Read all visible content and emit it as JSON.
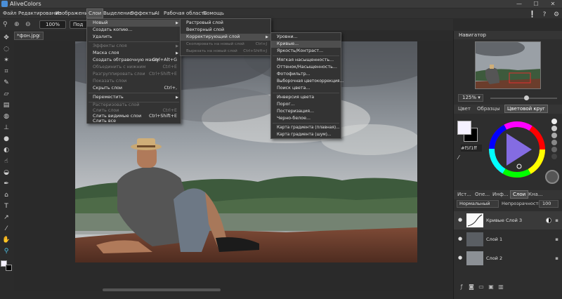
{
  "app": {
    "title": "AliveColors"
  },
  "window_controls": {
    "minimize": "—",
    "maximize": "☐",
    "close": "✕"
  },
  "menubar": {
    "items": [
      "Файл",
      "Редактирование",
      "Изображение",
      "Слои",
      "Выделение",
      "Эффекты",
      "AI",
      "Рабочая область",
      "Помощь"
    ],
    "active": "Слои",
    "right_icons": [
      "notification-icon",
      "help-icon",
      "settings-icon"
    ],
    "right_glyphs": [
      "❕",
      "?",
      "⚙"
    ]
  },
  "options_bar": {
    "zoom_value": "100%",
    "fit_button": "Под р"
  },
  "document": {
    "tab_label": "*фон.jpg",
    "tab_close": "×"
  },
  "layers_menu": {
    "items": [
      {
        "label": "Новый",
        "arrow": true,
        "highlight": true
      },
      {
        "label": "Создать копию...",
        "enabled": true
      },
      {
        "label": "Удалить",
        "enabled": true
      },
      {
        "sep": true
      },
      {
        "label": "Эффекты слоя",
        "enabled": false,
        "arrow": true
      },
      {
        "label": "Маска слоя",
        "enabled": true,
        "arrow": true
      },
      {
        "label": "Создать обтравочную маску",
        "shortcut": "Ctrl+Alt+G",
        "enabled": true
      },
      {
        "label": "Объединить с нижним",
        "shortcut": "Ctrl+E",
        "enabled": false
      },
      {
        "label": "Разгруппировать слои",
        "shortcut": "Ctrl+Shift+E",
        "enabled": false
      },
      {
        "label": "Показать слои",
        "enabled": false
      },
      {
        "label": "Скрыть слои",
        "shortcut": "Ctrl+,",
        "enabled": true
      },
      {
        "sep": true
      },
      {
        "label": "Переместить",
        "arrow": true,
        "enabled": true
      },
      {
        "sep": true
      },
      {
        "label": "Растеризовать слой",
        "enabled": false
      },
      {
        "label": "Слить слои",
        "shortcut": "Ctrl+E",
        "enabled": false
      },
      {
        "label": "Слить видимые слои",
        "shortcut": "Ctrl+Shift+E",
        "enabled": true
      },
      {
        "label": "Слить все",
        "enabled": true
      }
    ]
  },
  "new_submenu": {
    "items": [
      {
        "label": "Растровый слой",
        "enabled": true
      },
      {
        "label": "Векторный слой",
        "enabled": true
      },
      {
        "label": "Корректирующий слой",
        "arrow": true,
        "highlight": true
      },
      {
        "label": "Скопировать на новый слой",
        "shortcut": "Ctrl+J",
        "enabled": false
      },
      {
        "label": "Вырезать на новый слой",
        "shortcut": "Ctrl+Shift+J",
        "enabled": false
      }
    ]
  },
  "adjust_submenu": {
    "items": [
      {
        "label": "Уровни..."
      },
      {
        "label": "Кривые...",
        "highlight": true
      },
      {
        "label": "Яркость/Контраст..."
      },
      {
        "sep": true
      },
      {
        "label": "Мягкая насыщенность..."
      },
      {
        "label": "Оттенок/Насыщенность..."
      },
      {
        "label": "Фотофильтр..."
      },
      {
        "label": "Выборочная цветокоррекция..."
      },
      {
        "label": "Поиск цвета..."
      },
      {
        "sep": true
      },
      {
        "label": "Инверсия цвета"
      },
      {
        "label": "Порог..."
      },
      {
        "label": "Постеризация..."
      },
      {
        "label": "Черно-белое..."
      },
      {
        "sep": true
      },
      {
        "label": "Карта градиента (плавная)..."
      },
      {
        "label": "Карта градиента (шум)..."
      }
    ]
  },
  "navigator": {
    "title": "Навигатор",
    "zoom": "125%",
    "zoom_arrow": "▾"
  },
  "color_panel": {
    "tabs": [
      "Цвет",
      "Образцы",
      "Цветовой круг"
    ],
    "active_tab": "Цветовой круг",
    "hex": "#f5f1ff",
    "fg_color": "#f5f1ff",
    "bg_color": "#000000"
  },
  "layers_panel": {
    "tabs": [
      "Ист...",
      "Опе...",
      "Инф...",
      "Слои",
      "Кна..."
    ],
    "active_tab": "Слои",
    "blend_mode": "Нормальный",
    "opacity_label": "Непрозрачность",
    "opacity_value": "100",
    "layers": [
      {
        "name": "Кривые Слой 3",
        "active": true
      },
      {
        "name": "Слой 1",
        "active": false
      },
      {
        "name": "Слой 2",
        "active": false
      }
    ]
  },
  "colors": {
    "accent": "#4fc3e8",
    "menu_bg": "#333333",
    "panel_bg": "#2e2e2e"
  }
}
